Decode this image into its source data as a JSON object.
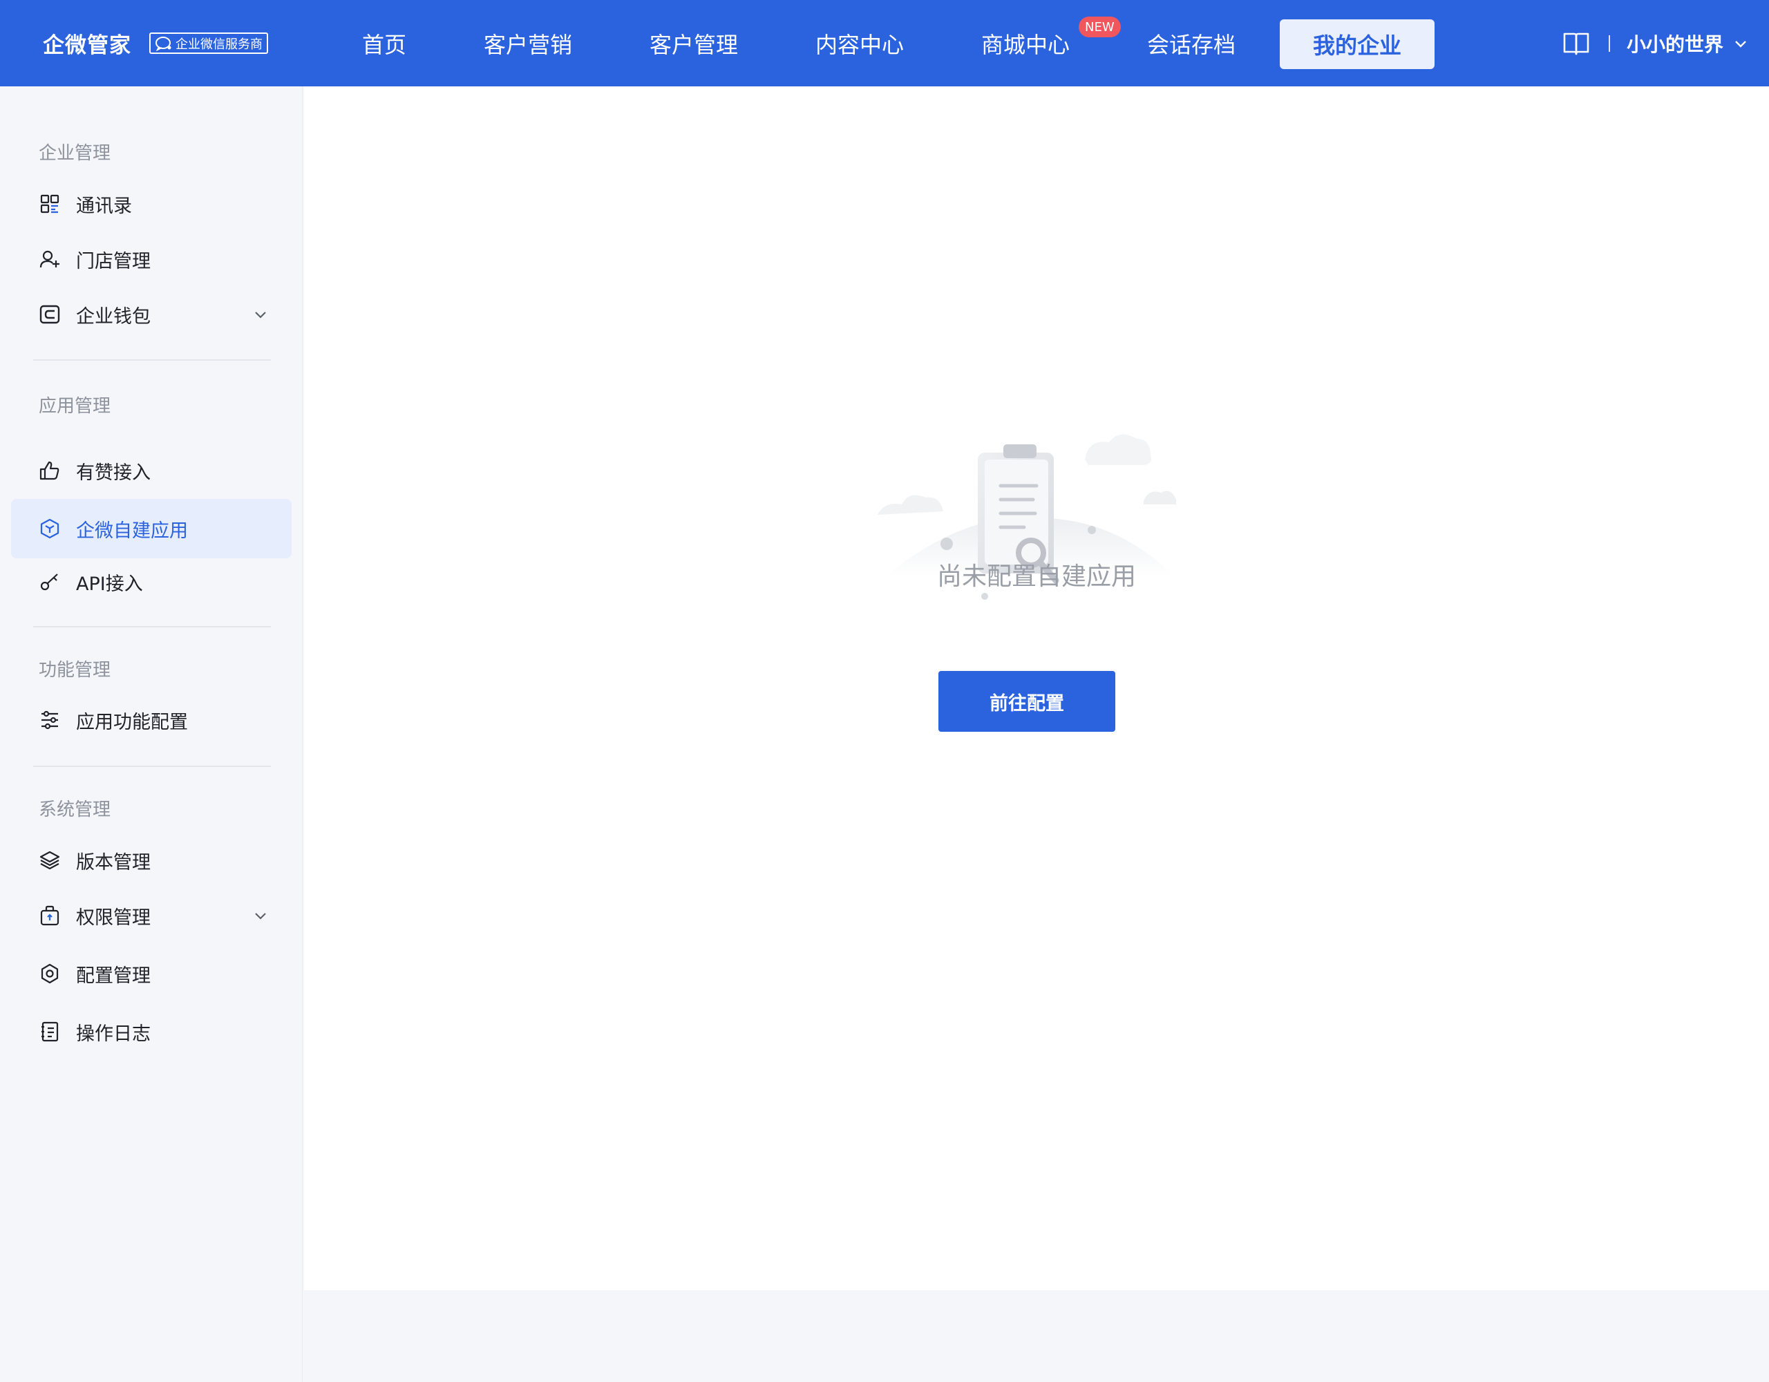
{
  "brand": {
    "name": "企微管家",
    "badge": "企业微信服务商"
  },
  "nav": {
    "items": [
      {
        "label": "首页"
      },
      {
        "label": "客户营销"
      },
      {
        "label": "客户管理"
      },
      {
        "label": "内容中心"
      },
      {
        "label": "商城中心",
        "badge": "NEW"
      },
      {
        "label": "会话存档"
      },
      {
        "label": "我的企业",
        "active": true
      }
    ]
  },
  "user": {
    "name": "小小的世界"
  },
  "sidebar": {
    "groups": [
      {
        "title": "企业管理",
        "items": [
          {
            "label": "通讯录",
            "icon": "contacts-grid-icon"
          },
          {
            "label": "门店管理",
            "icon": "user-add-icon"
          },
          {
            "label": "企业钱包",
            "icon": "wallet-icon",
            "expandable": true
          }
        ]
      },
      {
        "title": "应用管理",
        "items": [
          {
            "label": "有赞接入",
            "icon": "thumbs-up-icon"
          },
          {
            "label": "企微自建应用",
            "icon": "cube-icon",
            "active": true
          },
          {
            "label": "API接入",
            "icon": "key-icon"
          }
        ]
      },
      {
        "title": "功能管理",
        "items": [
          {
            "label": "应用功能配置",
            "icon": "sliders-icon"
          }
        ]
      },
      {
        "title": "系统管理",
        "items": [
          {
            "label": "版本管理",
            "icon": "layers-icon"
          },
          {
            "label": "权限管理",
            "icon": "lock-bag-icon",
            "expandable": true
          },
          {
            "label": "配置管理",
            "icon": "settings-icon"
          },
          {
            "label": "操作日志",
            "icon": "log-book-icon"
          }
        ]
      }
    ]
  },
  "main": {
    "empty_text": "尚未配置自建应用",
    "cta_label": "前往配置"
  },
  "colors": {
    "primary": "#2b62de",
    "active_bg": "#e6edfc",
    "badge_red": "#f0565e",
    "muted_text": "#9a9ea6"
  }
}
